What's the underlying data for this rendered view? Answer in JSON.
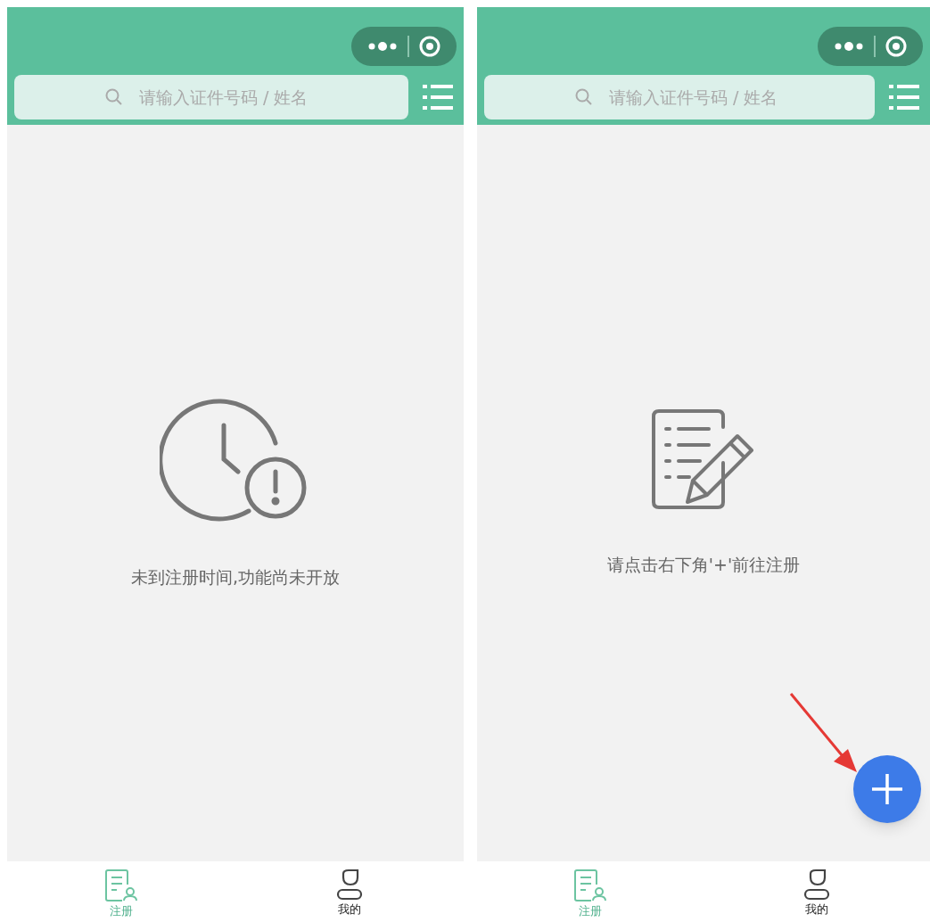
{
  "screens": [
    {
      "search": {
        "placeholder": "请输入证件号码 / 姓名"
      },
      "empty": {
        "kind": "clock",
        "message": "未到注册时间,功能尚未开放"
      },
      "fab": false,
      "pointer_arrow": false,
      "tabs": [
        {
          "label": "注册",
          "kind": "form",
          "selected": true
        },
        {
          "label": "我的",
          "kind": "person",
          "selected": false
        }
      ]
    },
    {
      "search": {
        "placeholder": "请输入证件号码 / 姓名"
      },
      "empty": {
        "kind": "form",
        "message": "请点击右下角'+'前往注册"
      },
      "fab": true,
      "pointer_arrow": true,
      "tabs": [
        {
          "label": "注册",
          "kind": "form",
          "selected": true
        },
        {
          "label": "我的",
          "kind": "person",
          "selected": false
        }
      ]
    }
  ]
}
